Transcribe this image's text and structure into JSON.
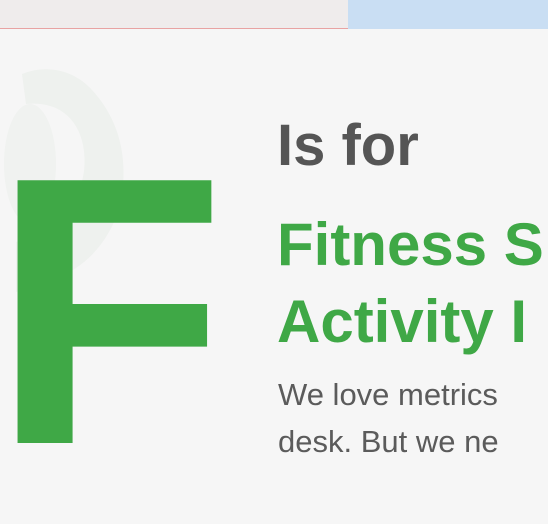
{
  "header_strip": {
    "left_color": "#efecec",
    "right_color": "#c9def3",
    "border_color": "#e8a3a3"
  },
  "hero": {
    "letter": "F",
    "subtitle": "Is for",
    "headline_lines": [
      "Fitness S",
      "Activity I"
    ],
    "body_lines": [
      "We love metrics",
      "desk. But we ne"
    ],
    "colors": {
      "accent_green": "#3fa846",
      "dark_text": "#555555",
      "body_text": "#5b5b5b",
      "background": "#f6f6f6"
    }
  }
}
